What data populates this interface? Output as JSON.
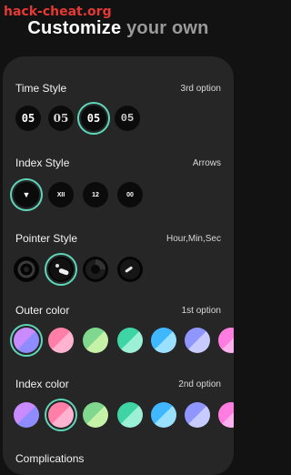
{
  "watermark": "hack-cheat.org",
  "headline": {
    "bright": "Customize",
    "dim": "your own"
  },
  "time_style": {
    "title": "Time Style",
    "value": "3rd option",
    "options": [
      "05",
      "05",
      "05",
      "05"
    ],
    "selected_index": 2
  },
  "index_style": {
    "title": "Index Style",
    "value": "Arrows",
    "options": [
      "▼",
      "XII",
      "12",
      "00"
    ],
    "selected_index": 0
  },
  "pointer_style": {
    "title": "Pointer Style",
    "value": "Hour,Min,Sec",
    "selected_index": 1
  },
  "outer_color": {
    "title": "Outer color",
    "value": "1st option",
    "selected_index": 0,
    "swatches": [
      "#c98bff",
      "#ff7fa8",
      "#7fd88e",
      "#3fd4a4",
      "#3fb8ff",
      "#8f96ff",
      "#ff7de0"
    ]
  },
  "index_color": {
    "title": "Index color",
    "value": "2nd option",
    "selected_index": 1,
    "swatches": [
      "#c98bff",
      "#ff7fa8",
      "#7fd88e",
      "#3fd4a4",
      "#3fb8ff",
      "#8f96ff",
      "#ff7de0"
    ]
  },
  "complications": {
    "title": "Complications"
  },
  "colors": {
    "accent": "#5ed6ba",
    "background": "#121212",
    "panel": "#262626"
  }
}
